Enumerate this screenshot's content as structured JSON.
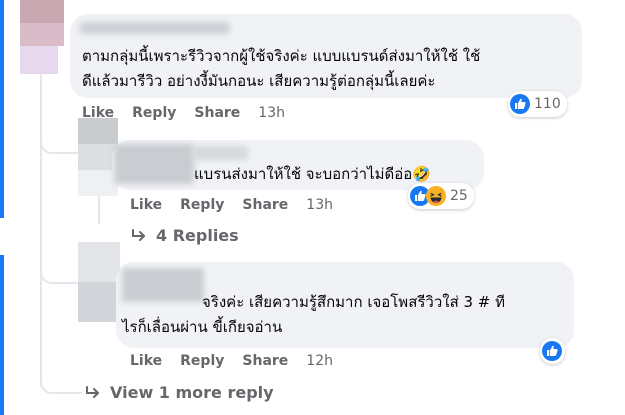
{
  "comment_main": {
    "text_line1": "ตามกลุ่มนี้เพราะรีวิวจากผู้ใช้จริงค่ะ แบบแบรนด์ส่งมาให้ใช้ ใช้",
    "text_line2": "ดีแล้วมารีวิว อย่างงี้มันกอนะ เสียความรู้ต่อกลุ่มนี้เลยค่ะ",
    "actions": {
      "like": "Like",
      "reply": "Reply",
      "share": "Share",
      "time": "13h"
    },
    "reaction_count": "110",
    "reaction_icons": [
      "like-icon"
    ]
  },
  "reply_1": {
    "text_line1": "แบรนส่งมาให้ใช้ จะบอกว่าไม่ดีอ่อ🤣",
    "actions": {
      "like": "Like",
      "reply": "Reply",
      "share": "Share",
      "time": "13h"
    },
    "reaction_count": "25",
    "reaction_icons": [
      "like-icon",
      "laugh-icon"
    ],
    "replies_link": "4 Replies"
  },
  "reply_2": {
    "text_line1": "จริงค่ะ เสียความรู้สึกมาก เจอโพสรีวิวใส่ 3 # ที",
    "text_line2": "ไรก็เลื่อนผ่าน ขี้เกียจอ่าน",
    "actions": {
      "like": "Like",
      "reply": "Reply",
      "share": "Share",
      "time": "12h"
    },
    "reaction_icons": [
      "like-icon"
    ]
  },
  "view_more": "View 1 more reply",
  "colors": {
    "brand_blue": "#1877f2",
    "bubble_bg": "#f0f2f5",
    "action_text": "#65676b",
    "thread_line": "#e4e6eb",
    "laugh_yellow": "#f7b125"
  }
}
